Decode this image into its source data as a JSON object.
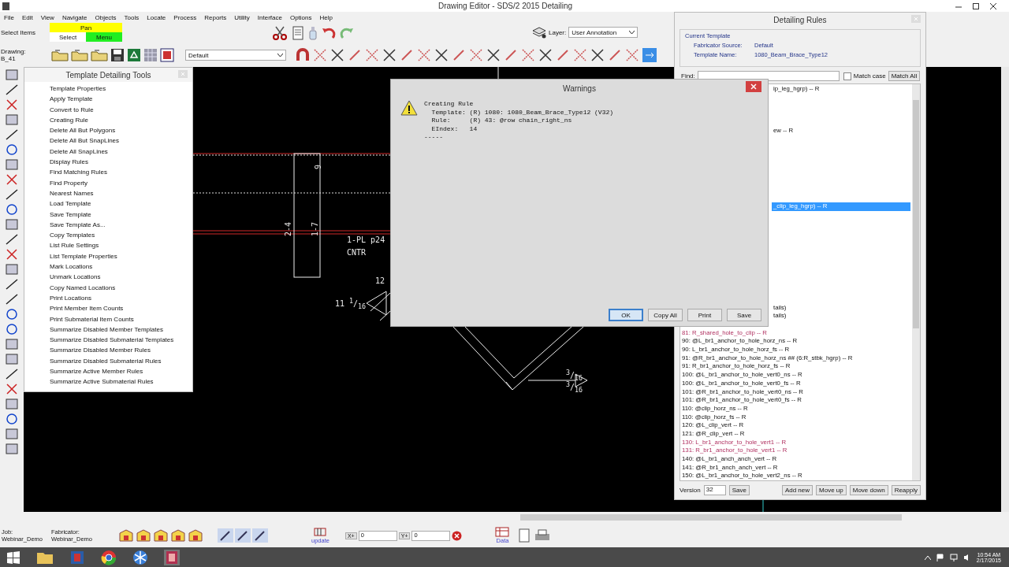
{
  "window": {
    "title": "Drawing Editor - SDS/2 2015 Detailing"
  },
  "menu": [
    "File",
    "Edit",
    "View",
    "Navigate",
    "Objects",
    "Tools",
    "Locate",
    "Process",
    "Reports",
    "Utility",
    "Interface",
    "Options",
    "Help"
  ],
  "toolbar": {
    "select_label": "Select Items",
    "modes": [
      {
        "label": "Pan",
        "kind": "pan"
      },
      {
        "label": "Select",
        "kind": "select"
      },
      {
        "label": "Menu",
        "kind": "menu"
      }
    ],
    "drawing_label": "Drawing:",
    "drawing_value": "B_41",
    "view_dropdown": "Default",
    "layer_label": "Layer:",
    "layer_dropdown": "User Annotation"
  },
  "canvas": {
    "labels": [
      {
        "text": "9"
      },
      {
        "text": "2-4"
      },
      {
        "text": "1-7"
      },
      {
        "text": "1-PL p24"
      },
      {
        "text": "CNTR"
      },
      {
        "text": "12"
      },
      {
        "text": "11 $^{1}$/$_{16}$"
      },
      {
        "text": "$^{3}$/$_{16}$"
      },
      {
        "text": "$^{3}$/$_{16}$"
      }
    ]
  },
  "tools_panel": {
    "title": "Template Detailing Tools",
    "items": [
      "Template Properties",
      "Apply Template",
      "Convert to Rule",
      "Creating Rule",
      "Delete All But Polygons",
      "Delete All But SnapLines",
      "Delete All SnapLines",
      "Display Rules",
      "Find Matching Rules",
      "Find Property",
      "Nearest Names",
      "Load Template",
      "Save Template",
      "Save Template As...",
      "Copy Templates",
      "List Rule Settings",
      "List Template Properties",
      "Mark Locations",
      "Unmark Locations",
      "Copy Named Locations",
      "Print Locations",
      "Print Member Item Counts",
      "Print Submaterial Item Counts",
      "Summarize Disabled Member Templates",
      "Summarize Disabled Submaterial Templates",
      "Summarize Disabled Member Rules",
      "Summarize Disabled Submaterial Rules",
      "Summarize Active Member Rules",
      "Summarize Active Submaterial Rules"
    ]
  },
  "warnings": {
    "title": "Warnings",
    "message": [
      "Creating Rule",
      "  Template: (R) 1080: 1080_Beam_Brace_Type12 (V32)",
      "  Rule:     (R) 43: @row chain_right_ns",
      "  EIndex:   14",
      "-----"
    ],
    "buttons": [
      {
        "label": "OK",
        "default": true
      },
      {
        "label": "Copy All",
        "default": false
      },
      {
        "label": "Print",
        "default": false
      },
      {
        "label": "Save",
        "default": false
      }
    ]
  },
  "rules": {
    "title": "Detailing Rules",
    "group_title": "Current Template",
    "fabricator_label": "Fabricator Source:",
    "fabricator_value": "Default",
    "template_label": "Template Name:",
    "template_value": "1080_Beam_Brace_Type12",
    "find_label": "Find:",
    "match_case": {
      "label": "Match case",
      "checked": false
    },
    "match_all": "Match All",
    "rows": [
      {
        "text": "ip_leg_hgrp) -- R",
        "kind": "partial",
        "selected": false,
        "inactive": false
      },
      {
        "text": "ew -- R",
        "kind": "partial",
        "selected": false,
        "inactive": false
      },
      {
        "text": "_clip_leg_hgrp) -- R",
        "kind": "partial",
        "selected": true,
        "inactive": false
      },
      {
        "text": "tails)",
        "kind": "partial",
        "selected": false,
        "inactive": false
      },
      {
        "text": "tails)",
        "kind": "partial",
        "selected": false,
        "inactive": false
      },
      {
        "text": "81: R_shared_hole_to_clip -- R",
        "kind": "full",
        "selected": false,
        "inactive": true
      },
      {
        "text": "90: @L_br1_anchor_to_hole_horz_ns -- R",
        "kind": "full",
        "selected": false,
        "inactive": false
      },
      {
        "text": "90: L_br1_anchor_to_hole_horz_fs -- R",
        "kind": "full",
        "selected": false,
        "inactive": false
      },
      {
        "text": "91: @R_br1_anchor_to_hole_horz_ns ## (6:R_stbk_hgrp) -- R",
        "kind": "full",
        "selected": false,
        "inactive": false
      },
      {
        "text": "91: R_br1_anchor_to_hole_horz_fs -- R",
        "kind": "full",
        "selected": false,
        "inactive": false
      },
      {
        "text": "100: @L_br1_anchor_to_hole_vert0_ns -- R",
        "kind": "full",
        "selected": false,
        "inactive": false
      },
      {
        "text": "100: @L_br1_anchor_to_hole_vert0_fs -- R",
        "kind": "full",
        "selected": false,
        "inactive": false
      },
      {
        "text": "101: @R_br1_anchor_to_hole_vert0_ns -- R",
        "kind": "full",
        "selected": false,
        "inactive": false
      },
      {
        "text": "101: @R_br1_anchor_to_hole_vert0_fs -- R",
        "kind": "full",
        "selected": false,
        "inactive": false
      },
      {
        "text": "110: @clip_horz_ns -- R",
        "kind": "full",
        "selected": false,
        "inactive": false
      },
      {
        "text": "110: @clip_horz_fs -- R",
        "kind": "full",
        "selected": false,
        "inactive": false
      },
      {
        "text": "120: @L_clip_vert -- R",
        "kind": "full",
        "selected": false,
        "inactive": false
      },
      {
        "text": "121: @R_clip_vert -- R",
        "kind": "full",
        "selected": false,
        "inactive": false
      },
      {
        "text": "130: L_br1_anchor_to_hole_vert1 -- R",
        "kind": "full",
        "selected": false,
        "inactive": true
      },
      {
        "text": "131: R_br1_anchor_to_hole_vert1 -- R",
        "kind": "full",
        "selected": false,
        "inactive": true
      },
      {
        "text": "140: @L_br1_anch_anch_vert -- R",
        "kind": "full",
        "selected": false,
        "inactive": false
      },
      {
        "text": "141: @R_br1_anch_anch_vert -- R",
        "kind": "full",
        "selected": false,
        "inactive": false
      },
      {
        "text": "150: @L_br1_anchor_to_hole_vert2_ns -- R",
        "kind": "full",
        "selected": false,
        "inactive": false
      }
    ],
    "version_label": "Version",
    "version_value": "32",
    "buttons": [
      "Save",
      "Add new",
      "Move up",
      "Move down",
      "Reapply"
    ]
  },
  "status": {
    "job_label": "Job:",
    "job_value": "Webinar_Demo",
    "fabricator_label": "Fabricator:",
    "fabricator_value": "Webinar_Demo",
    "update_label": "update",
    "x_label": "X+",
    "x_value": "0",
    "y_label": "Y+",
    "y_value": "0",
    "data_label": "Data"
  },
  "taskbar": {
    "time": "10:54 AM",
    "date": "2/17/2015"
  }
}
